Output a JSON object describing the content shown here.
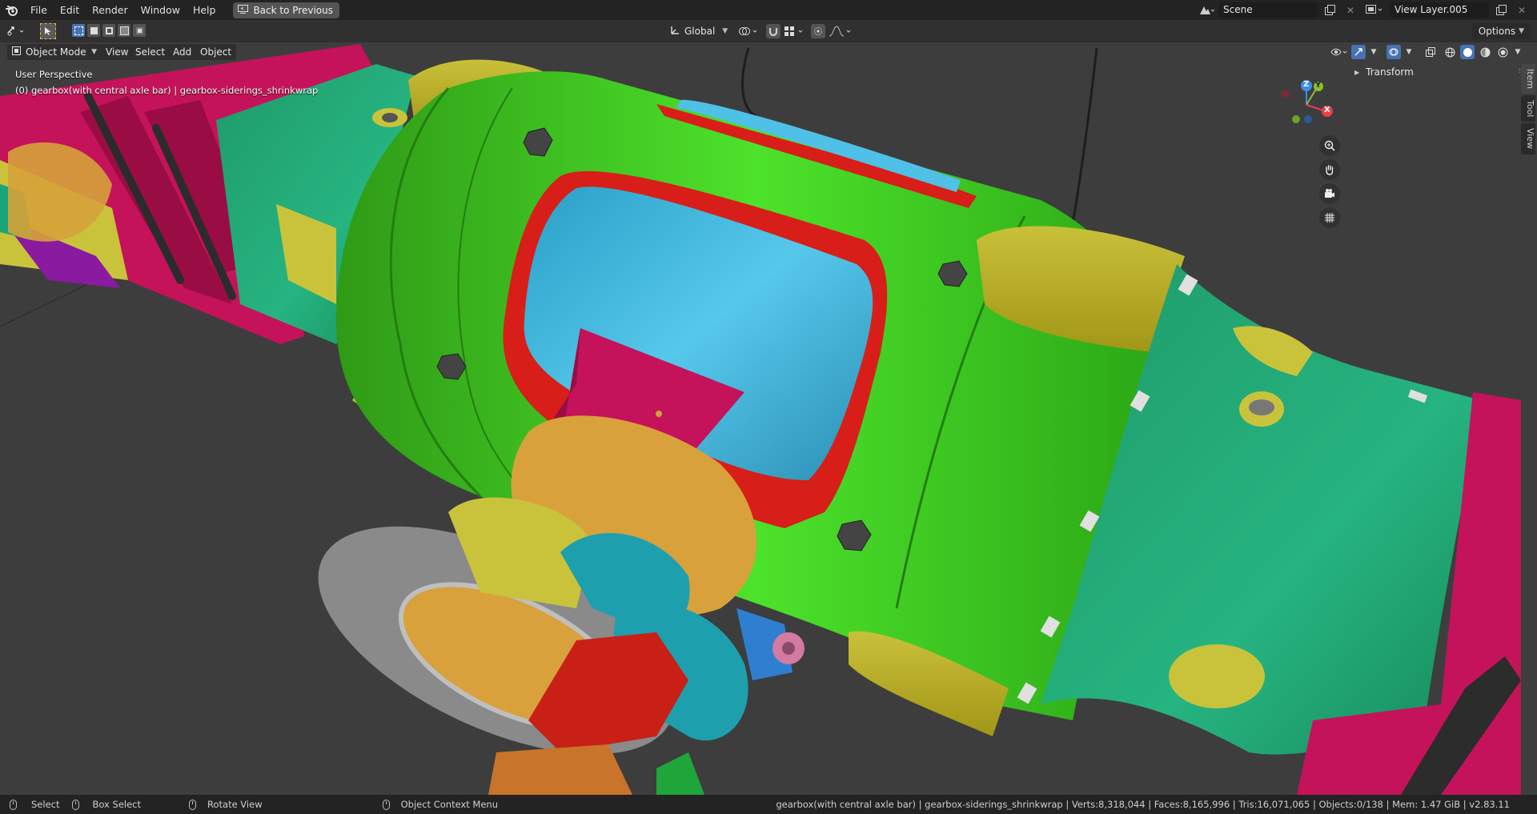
{
  "app": {
    "menu": [
      "File",
      "Edit",
      "Render",
      "Window",
      "Help"
    ],
    "back_button": "Back to Previous",
    "scene": "Scene",
    "view_layer": "View Layer.005"
  },
  "toolbar": {
    "orientation": "Global",
    "options_label": "Options"
  },
  "viewport_header": {
    "mode": "Object Mode",
    "menus": [
      "View",
      "Select",
      "Add",
      "Object"
    ]
  },
  "viewport": {
    "perspective_label": "User Perspective",
    "object_info": "(0) gearbox(with central axle bar) | gearbox-siderings_shrinkwrap",
    "gizmo_axes": {
      "x": "X",
      "y": "Y",
      "z": "Z"
    },
    "colors": {
      "x_axis": "#e8414c",
      "y_axis": "#8bbf2a",
      "z_axis": "#3e8ce8",
      "background": "#3d3d3d"
    }
  },
  "npanel": {
    "tabs": [
      "Item",
      "Tool",
      "View"
    ],
    "active_tab": "Item",
    "section": "Transform"
  },
  "statusbar": {
    "select": "Select",
    "box_select": "Box Select",
    "rotate_view": "Rotate View",
    "context_menu": "Object Context Menu",
    "stats": "gearbox(with central axle bar) | gearbox-siderings_shrinkwrap | Verts:8,318,044 | Faces:8,165,996 | Tris:16,071,065 | Objects:0/138 | Mem: 1.47 GiB | v2.83.11"
  },
  "icons": [
    "blender-logo",
    "editor-type-icon",
    "cursor-select-icon",
    "box-select-icon",
    "transform-orientation-icon",
    "pivot-icon",
    "snap-magnet-icon",
    "proportional-edit-icon",
    "visibility-icon",
    "gizmo-icon",
    "overlay-icon",
    "xray-icon",
    "wireframe-shading-icon",
    "solid-shading-icon",
    "material-shading-icon",
    "rendered-shading-icon",
    "zoom-icon",
    "hand-pan-icon",
    "camera-icon",
    "grid-ortho-icon"
  ]
}
